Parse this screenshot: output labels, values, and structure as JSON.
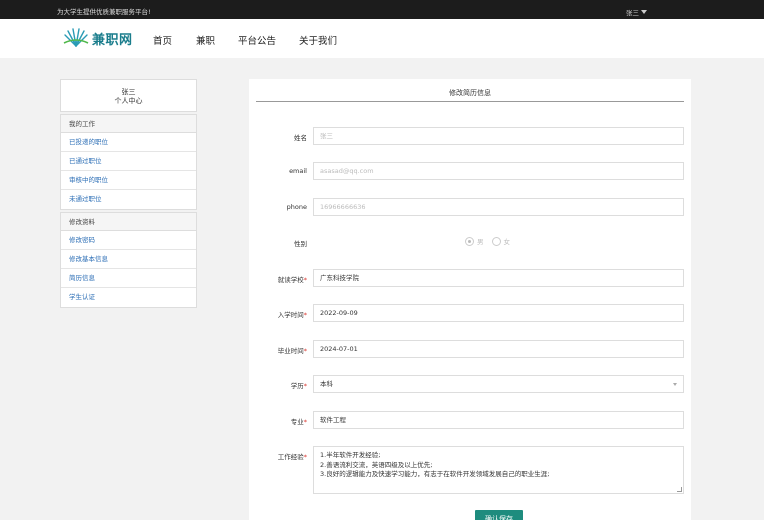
{
  "topbar": {
    "slogan": "为大学生提供优质兼职服务平台!",
    "user": "张三"
  },
  "header": {
    "logo_text": "兼职网",
    "nav": [
      "首页",
      "兼职",
      "平台公告",
      "关于我们"
    ]
  },
  "sidebar": {
    "profile_name": "张三",
    "profile_title": "个人中心",
    "groups": [
      {
        "title": "我的工作",
        "items": [
          "已投递的职位",
          "已通过职位",
          "审核中的职位",
          "未通过职位"
        ]
      },
      {
        "title": "修改资料",
        "items": [
          "修改密码",
          "修改基本信息",
          "简历信息",
          "学生认证"
        ]
      }
    ]
  },
  "form": {
    "title": "修改简历信息",
    "name": {
      "label": "姓名",
      "value": "张三"
    },
    "email": {
      "label": "email",
      "value": "asasad@qq.com"
    },
    "phone": {
      "label": "phone",
      "value": "16966666636"
    },
    "gender": {
      "label": "性别",
      "options": [
        "男",
        "女"
      ],
      "selected": "男"
    },
    "school": {
      "label": "就读学校",
      "value": "广东科技学院"
    },
    "enroll": {
      "label": "入学时间",
      "value": "2022-09-09"
    },
    "graduate": {
      "label": "毕业时间",
      "value": "2024-07-01"
    },
    "degree": {
      "label": "学历",
      "value": "本科"
    },
    "major": {
      "label": "专业",
      "value": "软件工程"
    },
    "experience": {
      "label": "工作经验",
      "lines": [
        "1.半年软件开发经验;",
        "2.善语流利交流，英语四级及以上优先;",
        "3.良好的逻辑能力及快速学习能力，有志于在软件开发领域发展自己的职业生涯;"
      ]
    },
    "required_mark": "*",
    "submit_label": "确认保存"
  },
  "colors": {
    "accent": "#1e8c7e",
    "link": "#2a6db5",
    "required": "#d9332c",
    "topbar": "#1c1c1c"
  }
}
